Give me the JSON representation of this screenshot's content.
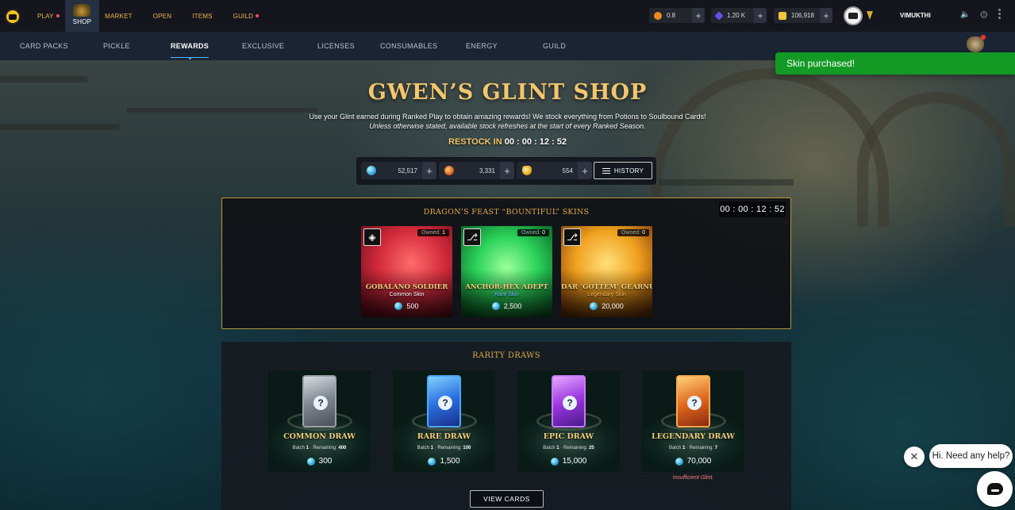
{
  "topnav": {
    "items": [
      {
        "label": "PLAY",
        "dot": true
      },
      {
        "label": "SHOP",
        "dot": false
      },
      {
        "label": "MARKET",
        "dot": false
      },
      {
        "label": "OPEN",
        "dot": false
      },
      {
        "label": "ITEMS",
        "dot": false
      },
      {
        "label": "GUILD",
        "dot": true
      }
    ]
  },
  "wallet": {
    "items": [
      {
        "name": "coin",
        "amount": "0.8",
        "color": "#f08a1e"
      },
      {
        "name": "crystal",
        "amount": "1.20 K",
        "color": "#6a4de8"
      },
      {
        "name": "credits",
        "amount": "106,918",
        "color": "#f4c53a"
      }
    ]
  },
  "user": {
    "name": "VIMUKTHI"
  },
  "subnav": {
    "tabs": [
      {
        "label": "CARD PACKS"
      },
      {
        "label": "PICKLE"
      },
      {
        "label": "REWARDS",
        "active": true
      },
      {
        "label": "EXCLUSIVE"
      },
      {
        "label": "LICENSES"
      },
      {
        "label": "CONSUMABLES"
      },
      {
        "label": "ENERGY"
      },
      {
        "label": "GUILD"
      }
    ]
  },
  "toast": {
    "message": "Skin purchased!"
  },
  "header": {
    "title": "GWEN’S GLINT SHOP",
    "description": "Use your Glint earned during Ranked Play to obtain amazing rewards! We stock everything from Potions to Soulbound Cards!",
    "description_italic": "Unless otherwise stated, available stock refreshes at the start of every Ranked Season.",
    "restock_label": "RESTOCK IN",
    "restock_time": "00 : 00 : 12 : 52"
  },
  "balances": {
    "items": [
      {
        "name": "glint",
        "amount": "52,517"
      },
      {
        "name": "potion-red",
        "amount": "3,331"
      },
      {
        "name": "potion-gold",
        "amount": "554"
      }
    ],
    "history_label": "HISTORY"
  },
  "featured": {
    "title": "DRAGON’S FEAST “BOUNTIFUL” SKINS",
    "timer": "00 : 00 : 12 : 52",
    "skins": [
      {
        "name": "GOBALANO SOLDIER",
        "rarity": "Common Skin",
        "rarity_color": "#ffffff",
        "owned_label": "Owned:",
        "owned": "1",
        "price": "500"
      },
      {
        "name": "ANCHOR-HEX ADEPT",
        "rarity": "Rare Skin",
        "rarity_color": "#5fc7ff",
        "owned_label": "Owned:",
        "owned": "0",
        "price": "2,500"
      },
      {
        "name": "DAR ‘GOTTEM’ GEARNUT",
        "rarity": "Legendary Skin",
        "rarity_color": "#ffb84d",
        "owned_label": "Owned:",
        "owned": "0",
        "price": "20,000"
      }
    ]
  },
  "rarity_draws": {
    "title": "RARITY DRAWS",
    "draws": [
      {
        "name": "COMMON DRAW",
        "batch_label": "Batch",
        "batch": "1",
        "remaining_label": "Remaining:",
        "remaining": "400",
        "price": "300"
      },
      {
        "name": "RARE DRAW",
        "batch_label": "Batch",
        "batch": "1",
        "remaining_label": "Remaining:",
        "remaining": "100",
        "price": "1,500"
      },
      {
        "name": "EPIC DRAW",
        "batch_label": "Batch",
        "batch": "1",
        "remaining_label": "Remaining:",
        "remaining": "25",
        "price": "15,000"
      },
      {
        "name": "LEGENDARY DRAW",
        "batch_label": "Batch",
        "batch": "1",
        "remaining_label": "Remaining:",
        "remaining": "7",
        "price": "70,000"
      }
    ],
    "insufficient": "Insufficient Glint.",
    "view_cards_label": "VIEW CARDS"
  },
  "help": {
    "bubble_text": "Hi. Need any help?"
  }
}
